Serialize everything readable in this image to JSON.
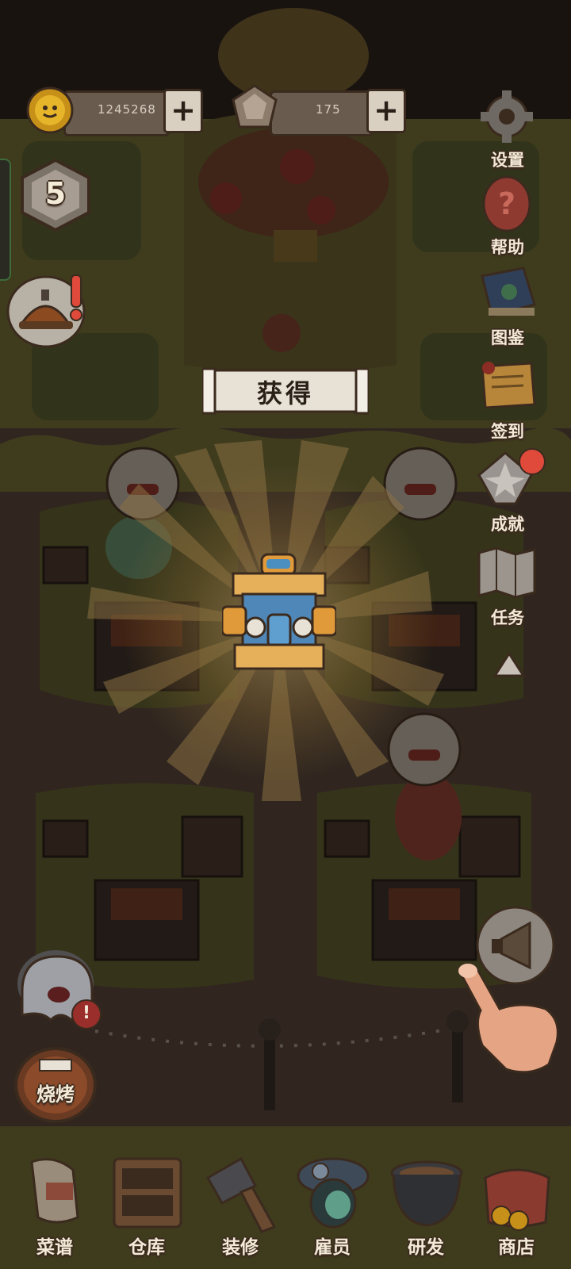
{
  "resources": {
    "coins": {
      "value": "1245268",
      "icon": "coin-icon",
      "add_icon": "plus-icon"
    },
    "gems": {
      "value": "175",
      "icon": "gem-icon",
      "add_icon": "plus-icon"
    }
  },
  "level": {
    "value": "5"
  },
  "popup": {
    "title": "获得"
  },
  "side_menu": {
    "settings": "设置",
    "help": "帮助",
    "collection": "图鉴",
    "checkin": "签到",
    "achievement": "成就",
    "tasks": "任务"
  },
  "grill_button": {
    "label": "烧烤"
  },
  "bottom_nav": [
    {
      "label": "菜谱",
      "icon": "recipe-scroll-icon"
    },
    {
      "label": "仓库",
      "icon": "warehouse-cabinet-icon"
    },
    {
      "label": "装修",
      "icon": "hammer-icon"
    },
    {
      "label": "雇员",
      "icon": "employee-icon"
    },
    {
      "label": "研发",
      "icon": "pot-icon"
    },
    {
      "label": "商店",
      "icon": "shop-bag-icon"
    }
  ],
  "colors": {
    "ground": "#6b6a33",
    "path": "#4c3f35",
    "ray": "#ffd27a",
    "badge_red": "#e04a3a"
  }
}
